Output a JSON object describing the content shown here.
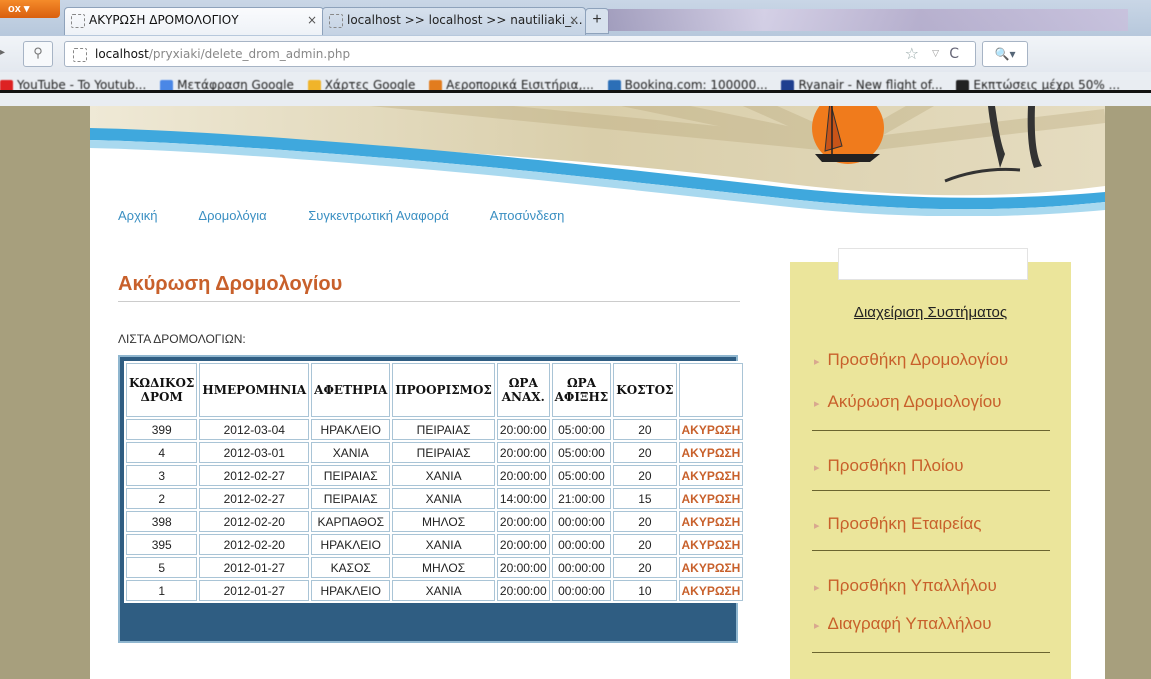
{
  "browser": {
    "menu_button": "ox",
    "tabs": [
      {
        "label": "ΑΚΥΡΩΣΗ ΔΡΟΜΟΛΟΓΙΟΥ",
        "close": "×"
      },
      {
        "label": "localhost >> localhost >> nautiliaki_...",
        "close": "×"
      }
    ],
    "new_tab": "+",
    "url_host": "localhost",
    "url_path": "/pryxiaki/delete_drom_admin.php",
    "bookmarks": [
      "YouTube - To Youtub...",
      "Μετάφραση Google",
      "Χάρτες Google",
      "Αεροπορικά Εισιτήρια,...",
      "Booking.com: 100000...",
      "Ryanair - New flight of...",
      "Εκπτώσεις μέχρι 50% ..."
    ]
  },
  "nav": {
    "items": [
      "Αρχική",
      "Δρομολόγια",
      "Συγκεντρωτική Αναφορά",
      "Αποσύνδεση"
    ]
  },
  "main": {
    "title": "Ακύρωση Δρομολογίου",
    "list_label": "ΛΙΣΤΑ ΔΡΟΜΟΛΟΓΙΩΝ:",
    "table": {
      "headers": [
        "ΚΩΔΙΚΟΣ ΔΡΟΜ",
        "ΗΜΕΡΟΜΗΝΙΑ",
        "ΑΦΕΤΗΡΙΑ",
        "ΠΡΟΟΡΙΣΜΟΣ",
        "ΩΡΑ ΑΝΑΧ.",
        "ΩΡΑ ΑΦΙΞΗΣ",
        "ΚΟΣΤΟΣ",
        ""
      ],
      "rows": [
        [
          "399",
          "2012-03-04",
          "ΗΡΑΚΛΕΙΟ",
          "ΠΕΙΡΑΙΑΣ",
          "20:00:00",
          "05:00:00",
          "20",
          "ΑΚΥΡΩΣΗ"
        ],
        [
          "4",
          "2012-03-01",
          "ΧΑΝΙΑ",
          "ΠΕΙΡΑΙΑΣ",
          "20:00:00",
          "05:00:00",
          "20",
          "ΑΚΥΡΩΣΗ"
        ],
        [
          "3",
          "2012-02-27",
          "ΠΕΙΡΑΙΑΣ",
          "ΧΑΝΙΑ",
          "20:00:00",
          "05:00:00",
          "20",
          "ΑΚΥΡΩΣΗ"
        ],
        [
          "2",
          "2012-02-27",
          "ΠΕΙΡΑΙΑΣ",
          "ΧΑΝΙΑ",
          "14:00:00",
          "21:00:00",
          "15",
          "ΑΚΥΡΩΣΗ"
        ],
        [
          "398",
          "2012-02-20",
          "ΚΑΡΠΑΘΟΣ",
          "ΜΗΛΟΣ",
          "20:00:00",
          "00:00:00",
          "20",
          "ΑΚΥΡΩΣΗ"
        ],
        [
          "395",
          "2012-02-20",
          "ΗΡΑΚΛΕΙΟ",
          "ΧΑΝΙΑ",
          "20:00:00",
          "00:00:00",
          "20",
          "ΑΚΥΡΩΣΗ"
        ],
        [
          "5",
          "2012-01-27",
          "ΚΑΣΟΣ",
          "ΜΗΛΟΣ",
          "20:00:00",
          "00:00:00",
          "20",
          "ΑΚΥΡΩΣΗ"
        ],
        [
          "1",
          "2012-01-27",
          "ΗΡΑΚΛΕΙΟ",
          "ΧΑΝΙΑ",
          "20:00:00",
          "00:00:00",
          "10",
          "ΑΚΥΡΩΣΗ"
        ]
      ]
    }
  },
  "sidebar": {
    "title": "Διαχείριση Συστήματος",
    "items": [
      "Προσθήκη Δρομολογίου",
      "Ακύρωση Δρομολογίου",
      "Προσθήκη Πλοίου",
      "Προσθήκη Εταιρείας",
      "Προσθήκη Υπαλλήλου",
      "Διαγραφή Υπαλλήλου"
    ]
  },
  "colors": {
    "accent_orange": "#c8602b",
    "link_blue": "#3a8fc2",
    "sidebar_bg": "#ebe59b",
    "table_frame": "#2f5d82"
  }
}
